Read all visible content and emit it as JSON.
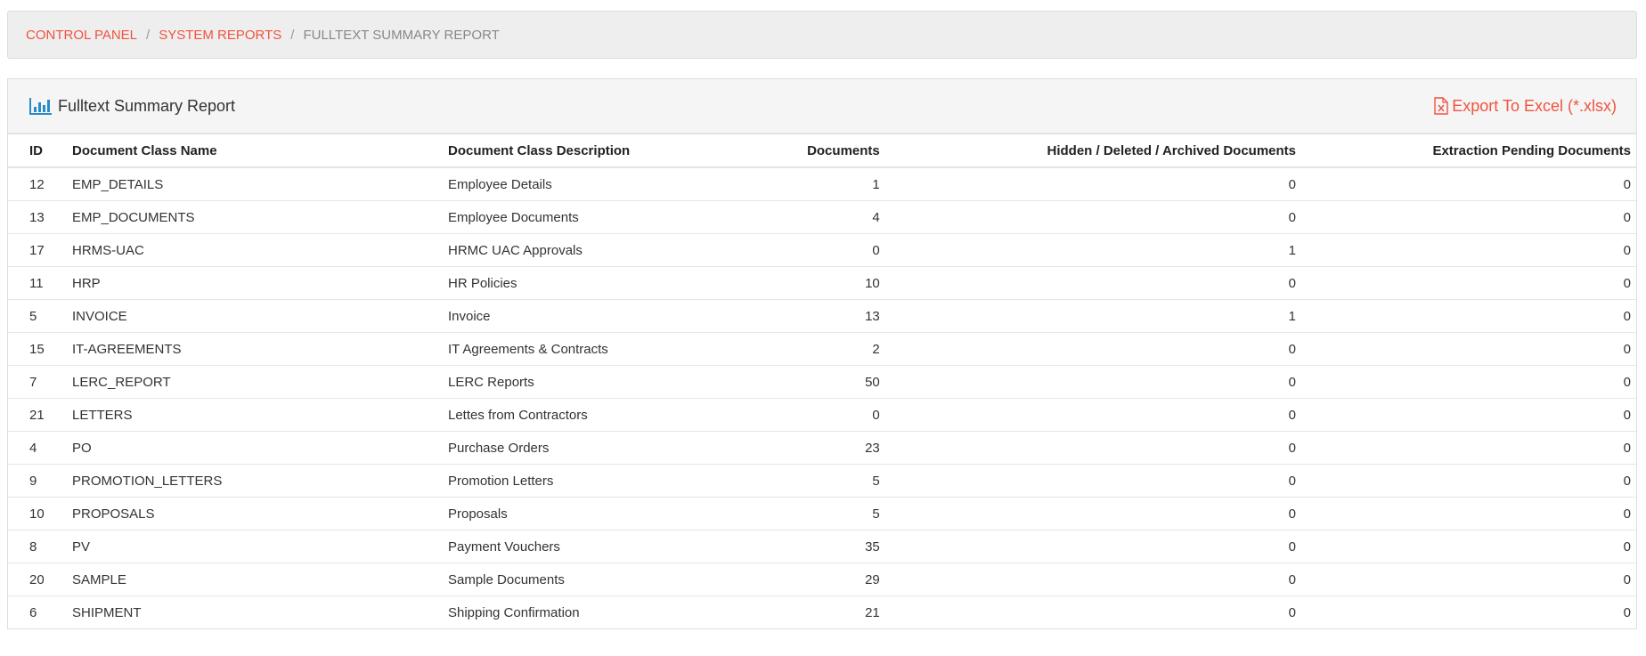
{
  "breadcrumb": {
    "items": [
      "CONTROL PANEL",
      "SYSTEM REPORTS"
    ],
    "current": "FULLTEXT SUMMARY REPORT",
    "separator": "/"
  },
  "panel": {
    "title": "Fulltext Summary Report",
    "title_icon": "bar-chart-icon",
    "export_label": "Export To Excel (*.xlsx)",
    "export_icon": "excel-file-icon"
  },
  "colors": {
    "link": "#f0533f",
    "icon": "#2a8bc7"
  },
  "table": {
    "headers": [
      "ID",
      "Document Class Name",
      "Document Class Description",
      "Documents",
      "Hidden / Deleted / Archived Documents",
      "Extraction Pending Documents"
    ],
    "rows": [
      [
        "12",
        "EMP_DETAILS",
        "Employee Details",
        "1",
        "0",
        "0"
      ],
      [
        "13",
        "EMP_DOCUMENTS",
        "Employee Documents",
        "4",
        "0",
        "0"
      ],
      [
        "17",
        "HRMS-UAC",
        "HRMC UAC Approvals",
        "0",
        "1",
        "0"
      ],
      [
        "11",
        "HRP",
        "HR Policies",
        "10",
        "0",
        "0"
      ],
      [
        "5",
        "INVOICE",
        "Invoice",
        "13",
        "1",
        "0"
      ],
      [
        "15",
        "IT-AGREEMENTS",
        "IT Agreements & Contracts",
        "2",
        "0",
        "0"
      ],
      [
        "7",
        "LERC_REPORT",
        "LERC Reports",
        "50",
        "0",
        "0"
      ],
      [
        "21",
        "LETTERS",
        "Lettes from Contractors",
        "0",
        "0",
        "0"
      ],
      [
        "4",
        "PO",
        "Purchase Orders",
        "23",
        "0",
        "0"
      ],
      [
        "9",
        "PROMOTION_LETTERS",
        "Promotion Letters",
        "5",
        "0",
        "0"
      ],
      [
        "10",
        "PROPOSALS",
        "Proposals",
        "5",
        "0",
        "0"
      ],
      [
        "8",
        "PV",
        "Payment Vouchers",
        "35",
        "0",
        "0"
      ],
      [
        "20",
        "SAMPLE",
        "Sample Documents",
        "29",
        "0",
        "0"
      ],
      [
        "6",
        "SHIPMENT",
        "Shipping Confirmation",
        "21",
        "0",
        "0"
      ]
    ]
  }
}
